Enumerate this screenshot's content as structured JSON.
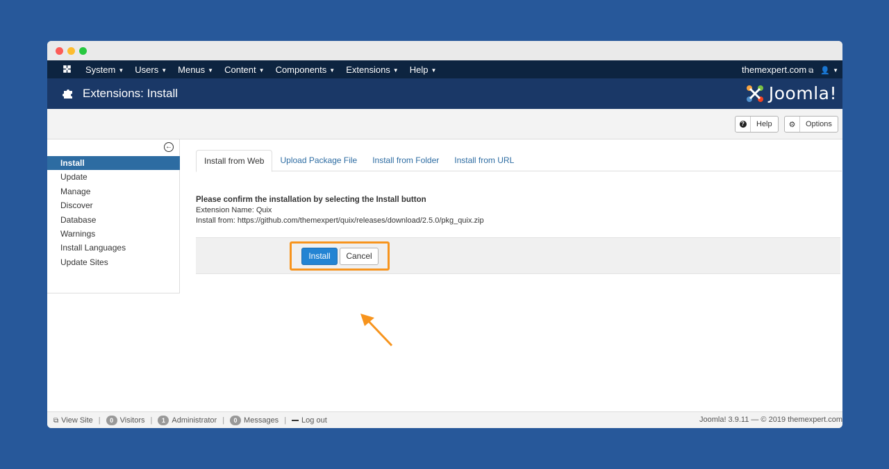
{
  "topnav": {
    "menus": [
      {
        "label": "System"
      },
      {
        "label": "Users"
      },
      {
        "label": "Menus"
      },
      {
        "label": "Content"
      },
      {
        "label": "Components"
      },
      {
        "label": "Extensions"
      },
      {
        "label": "Help"
      }
    ],
    "site_link": "themexpert.com"
  },
  "header": {
    "title": "Extensions: Install",
    "logo_text": "Joomla!"
  },
  "toolbar": {
    "help_label": "Help",
    "options_label": "Options"
  },
  "sidebar": {
    "items": [
      {
        "label": "Install",
        "active": true
      },
      {
        "label": "Update"
      },
      {
        "label": "Manage"
      },
      {
        "label": "Discover"
      },
      {
        "label": "Database"
      },
      {
        "label": "Warnings"
      },
      {
        "label": "Install Languages"
      },
      {
        "label": "Update Sites"
      }
    ]
  },
  "tabs": [
    {
      "label": "Install from Web",
      "active": true
    },
    {
      "label": "Upload Package File"
    },
    {
      "label": "Install from Folder"
    },
    {
      "label": "Install from URL"
    }
  ],
  "confirm": {
    "heading": "Please confirm the installation by selecting the Install button",
    "extension_name": "Extension Name: Quix",
    "install_from": "Install from: https://github.com/themexpert/quix/releases/download/2.5.0/pkg_quix.zip"
  },
  "actions": {
    "install_label": "Install",
    "cancel_label": "Cancel"
  },
  "statusbar": {
    "view_site": "View Site",
    "visitors_count": "0",
    "visitors_label": "Visitors",
    "admin_count": "1",
    "admin_label": "Administrator",
    "messages_count": "0",
    "messages_label": "Messages",
    "logout_label": "Log out",
    "version": "Joomla! 3.9.11 — © 2019 themexpert.com"
  },
  "colors": {
    "background": "#27589a",
    "topnav": "#0d2440",
    "header": "#1a3867",
    "accent": "#2d6ca2",
    "primary_button": "#2384d3",
    "highlight": "#f7941d"
  }
}
